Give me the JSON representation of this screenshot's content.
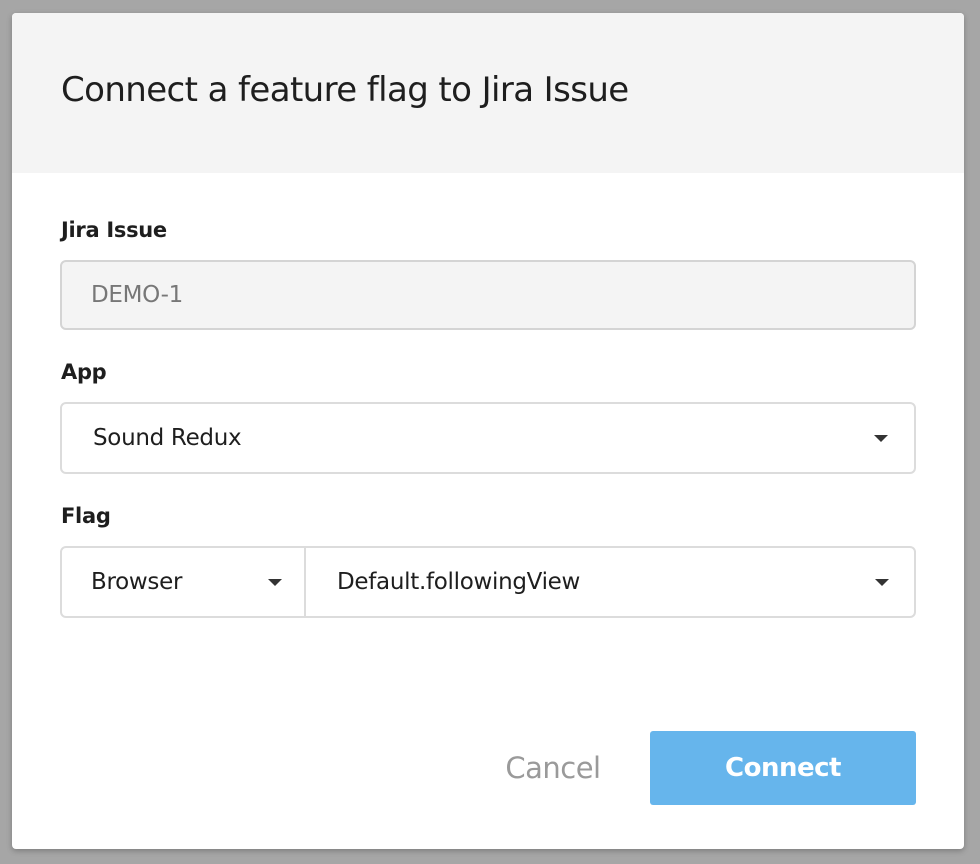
{
  "dialog": {
    "title": "Connect a feature flag to Jira Issue"
  },
  "jira_issue": {
    "label": "Jira Issue",
    "value": "DEMO-1"
  },
  "app": {
    "label": "App",
    "selected": "Sound Redux"
  },
  "flag": {
    "label": "Flag",
    "platform": "Browser",
    "name": "Default.followingView"
  },
  "actions": {
    "cancel_label": "Cancel",
    "connect_label": "Connect"
  },
  "icons": {
    "dropdown": "caret-down-icon"
  },
  "colors": {
    "primary_button": "#66b5ec",
    "header_background": "#f4f4f4",
    "overlay": "#a6a6a6"
  }
}
